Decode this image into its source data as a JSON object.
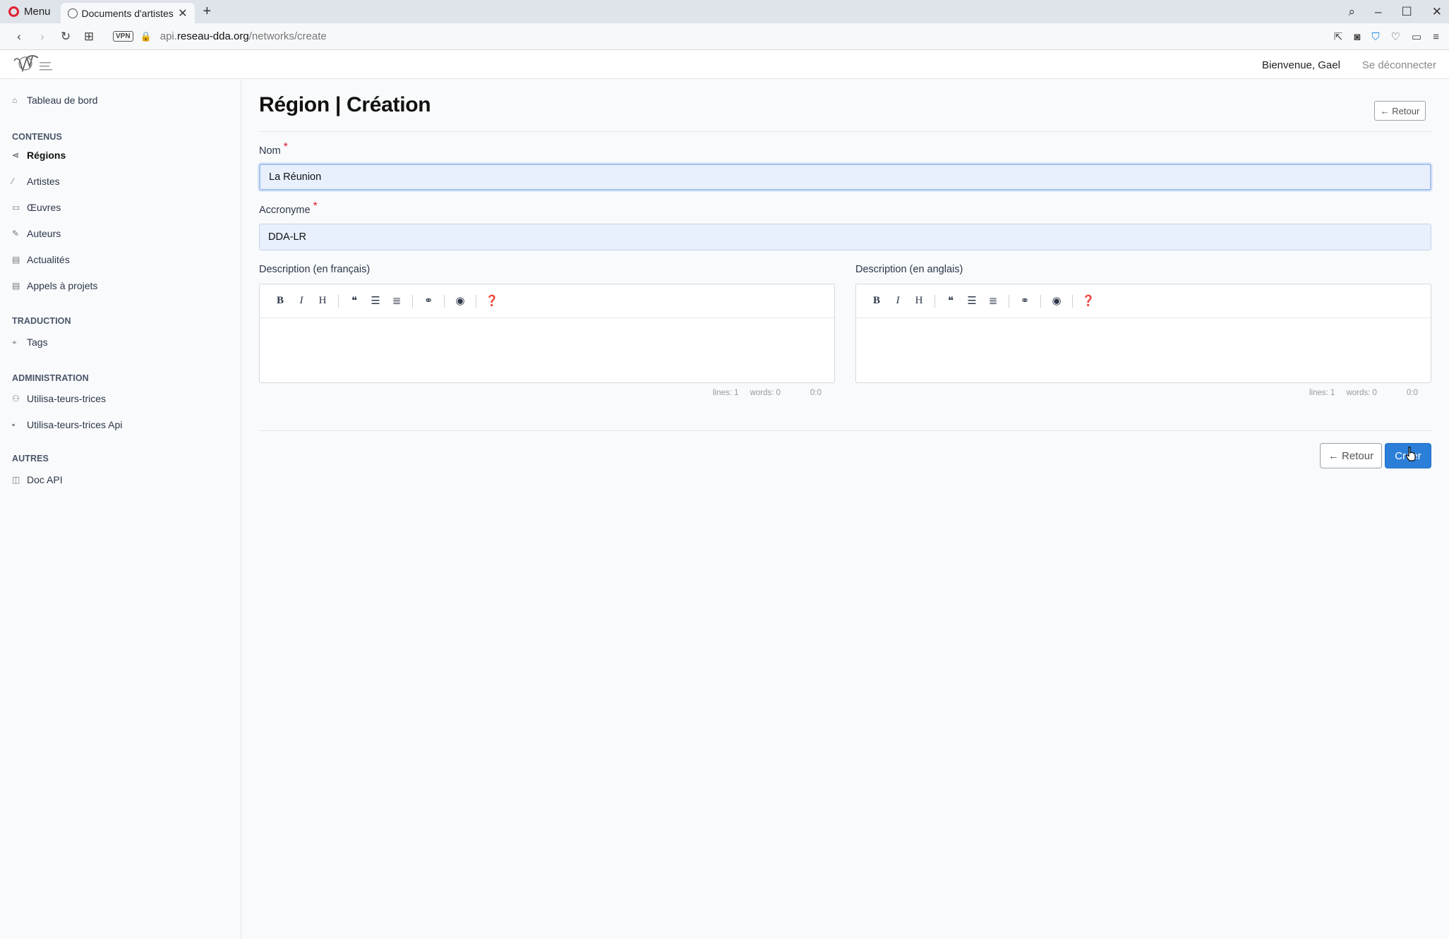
{
  "browser": {
    "menu_label": "Menu",
    "tab_title": "Documents d'artistes - A",
    "url_prefix": "api.",
    "url_host": "reseau-dda.org",
    "url_path": "/networks/create",
    "vpn_label": "VPN"
  },
  "header": {
    "welcome": "Bienvenue, Gael",
    "logout": "Se déconnecter"
  },
  "sidebar": {
    "dashboard": "Tableau de bord",
    "sections": [
      {
        "title": "CONTENUS",
        "items": [
          "Régions",
          "Artistes",
          "Œuvres",
          "Auteurs",
          "Actualités",
          "Appels à projets"
        ]
      },
      {
        "title": "TRADUCTION",
        "items": [
          "Tags"
        ]
      },
      {
        "title": "ADMINISTRATION",
        "items": [
          "Utilisa-teurs-trices",
          "Utilisa-teurs-trices Api"
        ]
      },
      {
        "title": "AUTRES",
        "items": [
          "Doc API"
        ]
      }
    ],
    "active_item": "Régions"
  },
  "page": {
    "title": "Région | Création",
    "back_top": "← Retour"
  },
  "form": {
    "name_label": "Nom",
    "name_value": "La Réunion",
    "acronym_label": "Accronyme",
    "acronym_value": "DDA-LR",
    "required_mark": "*",
    "desc_fr_label": "Description (en français)",
    "desc_en_label": "Description (en anglais)",
    "status": {
      "lines": "lines: 1",
      "words": "words: 0",
      "cursor": "0:0"
    }
  },
  "actions": {
    "back": "← Retour",
    "create": "Créer"
  },
  "colors": {
    "primary": "#2b7fd9",
    "required": "#e11d2e",
    "input_bg": "#e8f0fe"
  }
}
